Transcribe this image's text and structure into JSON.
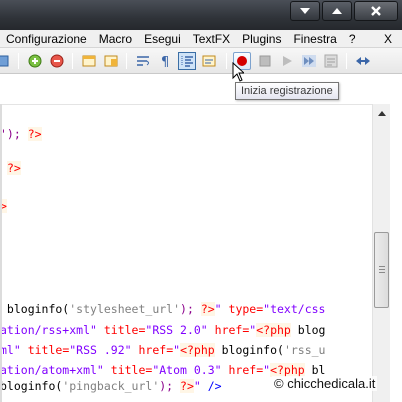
{
  "menu": {
    "items": [
      "Configurazione",
      "Macro",
      "Esegui",
      "TextFX",
      "Plugins",
      "Finestra",
      "?"
    ],
    "close_doc": "X"
  },
  "tooltip": {
    "text": "Inizia registrazione"
  },
  "code": {
    "lines": [
      [
        {
          "t": "'); ",
          "c": "punct"
        },
        {
          "t": "?>",
          "c": "php"
        }
      ],
      [
        {
          "t": " ",
          "c": "fn"
        },
        {
          "t": "?>",
          "c": "php"
        }
      ],
      [
        {
          "t": ">",
          "c": "php"
        }
      ],
      [
        {
          "t": " bloginfo(",
          "c": "fn"
        },
        {
          "t": "'stylesheet_url'",
          "c": "str"
        },
        {
          "t": "); ",
          "c": "punct"
        },
        {
          "t": "?>",
          "c": "php"
        },
        {
          "t": "\" ",
          "c": "attrv"
        },
        {
          "t": "type=",
          "c": "attr"
        },
        {
          "t": "\"text/css",
          "c": "attrv"
        }
      ],
      [
        {
          "t": "ation/rss+xml\" ",
          "c": "attrv"
        },
        {
          "t": "title=",
          "c": "attr"
        },
        {
          "t": "\"RSS 2.0\" ",
          "c": "attrv"
        },
        {
          "t": "href=",
          "c": "attr"
        },
        {
          "t": "\"",
          "c": "attrv"
        },
        {
          "t": "<?php",
          "c": "php"
        },
        {
          "t": " blog",
          "c": "fn"
        }
      ],
      [
        {
          "t": "ml\" ",
          "c": "attrv"
        },
        {
          "t": "title=",
          "c": "attr"
        },
        {
          "t": "\"RSS .92\" ",
          "c": "attrv"
        },
        {
          "t": "href=",
          "c": "attr"
        },
        {
          "t": "\"",
          "c": "attrv"
        },
        {
          "t": "<?php",
          "c": "php"
        },
        {
          "t": " bloginfo(",
          "c": "fn"
        },
        {
          "t": "'rss_u",
          "c": "str"
        }
      ],
      [
        {
          "t": "ation/atom+xml\" ",
          "c": "attrv"
        },
        {
          "t": "title=",
          "c": "attr"
        },
        {
          "t": "\"Atom 0.3\" ",
          "c": "attrv"
        },
        {
          "t": "href=",
          "c": "attr"
        },
        {
          "t": "\"",
          "c": "attrv"
        },
        {
          "t": "<?php",
          "c": "php"
        },
        {
          "t": " bl",
          "c": "fn"
        }
      ],
      [
        {
          "t": "bloginfo(",
          "c": "fn"
        },
        {
          "t": "'pingback_url'",
          "c": "str"
        },
        {
          "t": "); ",
          "c": "punct"
        },
        {
          "t": "?>",
          "c": "php"
        },
        {
          "t": "\" ",
          "c": "attrv"
        },
        {
          "t": "/>",
          "c": "tag"
        }
      ]
    ]
  },
  "watermark": {
    "text": "© chicchedicala.it"
  },
  "colors": {
    "record_red": "#d40000",
    "selection_blue": "#3a6ea5"
  }
}
